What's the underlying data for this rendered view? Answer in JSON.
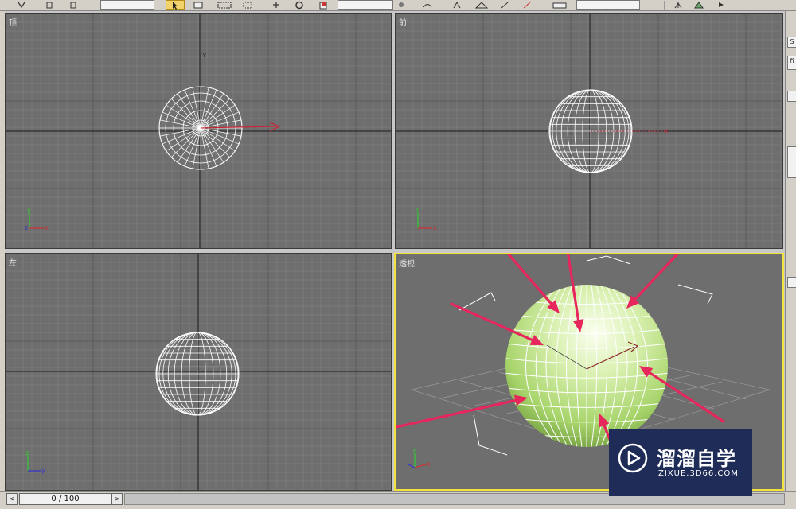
{
  "viewports": {
    "top": {
      "label": "顶"
    },
    "front": {
      "label": "前"
    },
    "left": {
      "label": "左"
    },
    "persp": {
      "label": "透视"
    }
  },
  "axis_labels": {
    "x": "x",
    "y": "y",
    "z": "z"
  },
  "timeline": {
    "position": "0 / 100",
    "prev_icon": "<",
    "next_icon": ">"
  },
  "command_panel": {
    "field1": "S",
    "field2": "fi"
  },
  "watermark": {
    "name": "溜溜自学",
    "url": "ZIXUE.3D66.COM"
  },
  "colors": {
    "viewport_bg": "#6e6e6e",
    "grid": "#8a8a8a",
    "active_border": "#f1e33a",
    "arrow": "#e8265e",
    "sphere": "#c6e89a",
    "watermark_bg": "#1f2c57"
  },
  "icons": [
    "select-arrow-icon",
    "region-select-icon",
    "move-icon",
    "rotate-icon",
    "scale-icon",
    "render-icon",
    "play-triangle-icon"
  ]
}
